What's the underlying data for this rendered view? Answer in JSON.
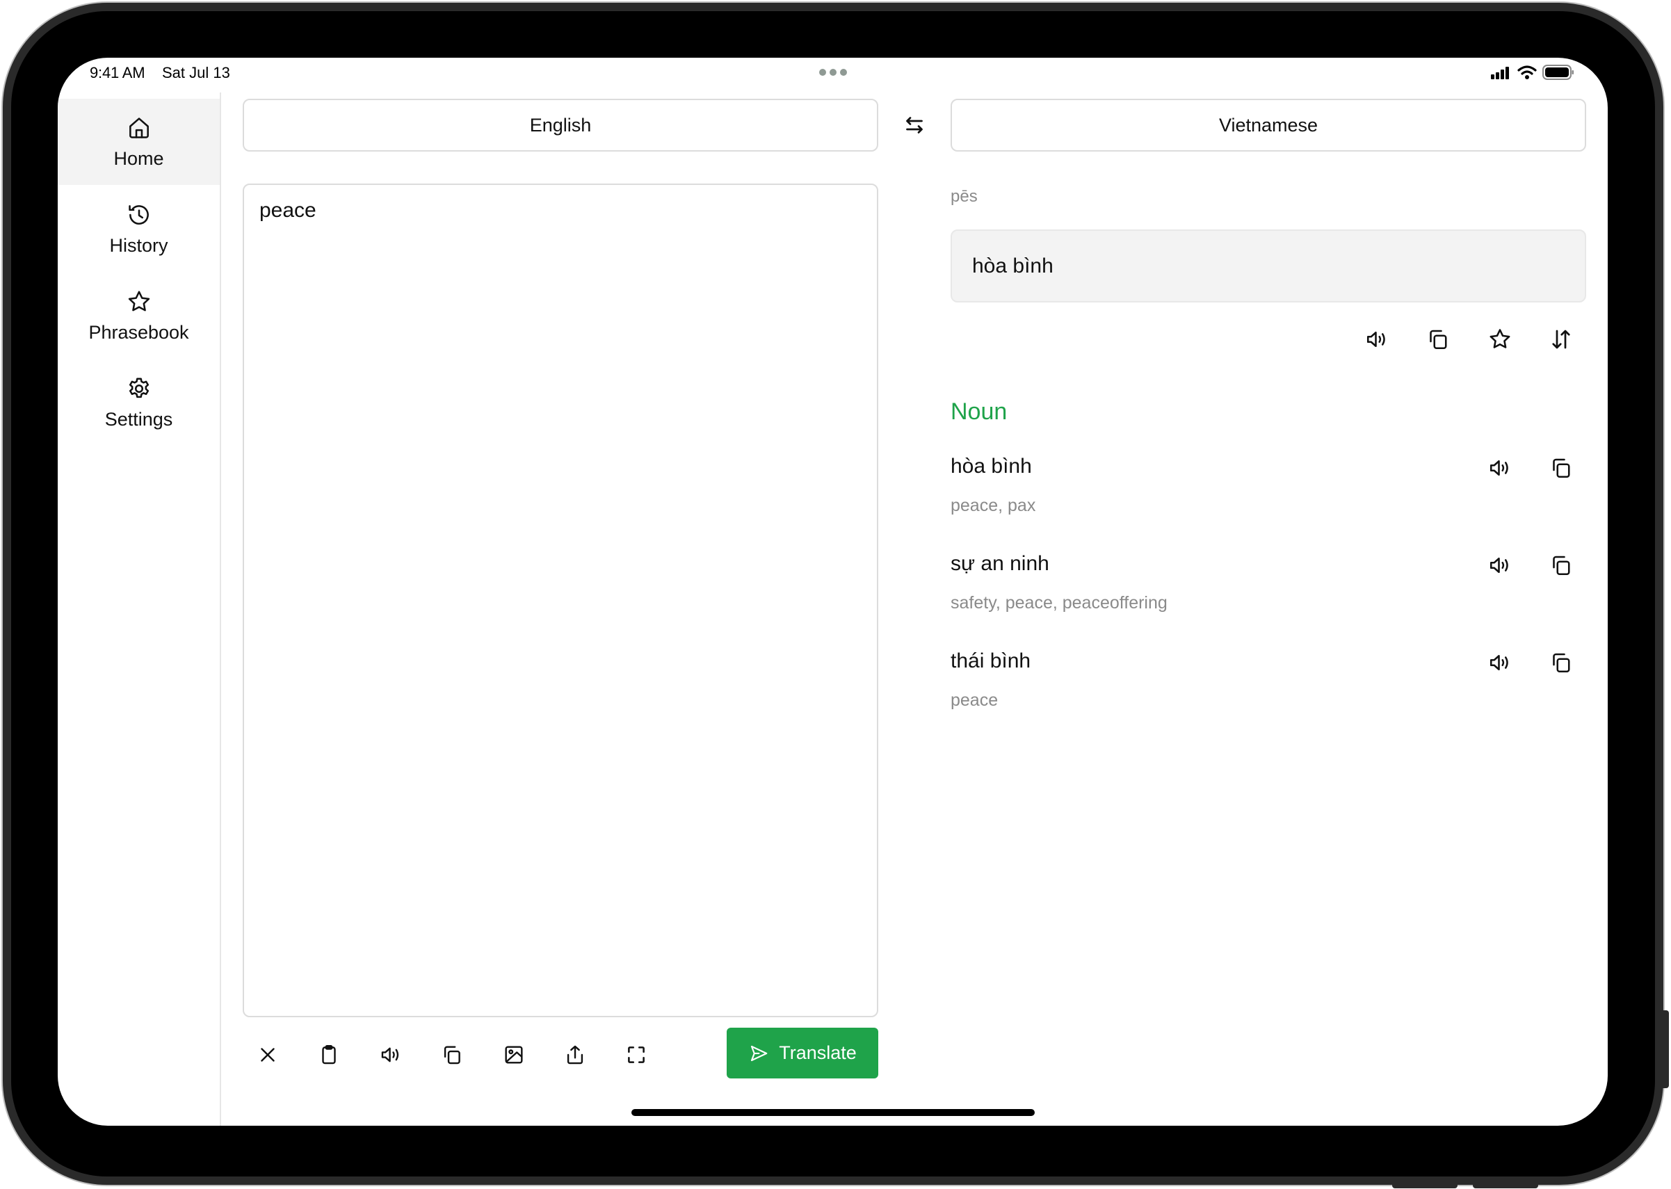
{
  "status_bar": {
    "time": "9:41 AM",
    "date": "Sat Jul 13",
    "icons": [
      "cellular-signal-icon",
      "wifi-icon",
      "battery-icon"
    ]
  },
  "sidebar": {
    "items": [
      {
        "label": "Home",
        "icon": "home-icon",
        "active": true
      },
      {
        "label": "History",
        "icon": "history-icon",
        "active": false
      },
      {
        "label": "Phrasebook",
        "icon": "star-icon",
        "active": false
      },
      {
        "label": "Settings",
        "icon": "gear-icon",
        "active": false
      }
    ]
  },
  "languages": {
    "source": "English",
    "target": "Vietnamese",
    "swap_icon": "swap-arrows-icon"
  },
  "source_input": {
    "value": "peace",
    "toolbar": [
      "close-icon",
      "clipboard-icon",
      "speaker-icon",
      "copy-icon",
      "image-icon",
      "share-icon",
      "fullscreen-icon"
    ]
  },
  "translate_button": {
    "label": "Translate",
    "icon": "send-icon",
    "color": "#1fa34a"
  },
  "result": {
    "phonetic": "pēs",
    "translation": "hòa bình",
    "actions": [
      "speaker-icon",
      "copy-icon",
      "star-icon",
      "sort-arrows-icon"
    ]
  },
  "dictionary": {
    "part_of_speech": "Noun",
    "accent_color": "#1fa34a",
    "entries": [
      {
        "word": "hòa bình",
        "meanings": "peace, pax"
      },
      {
        "word": "sự an ninh",
        "meanings": "safety, peace, peaceoffering"
      },
      {
        "word": "thái bình",
        "meanings": "peace"
      }
    ]
  }
}
